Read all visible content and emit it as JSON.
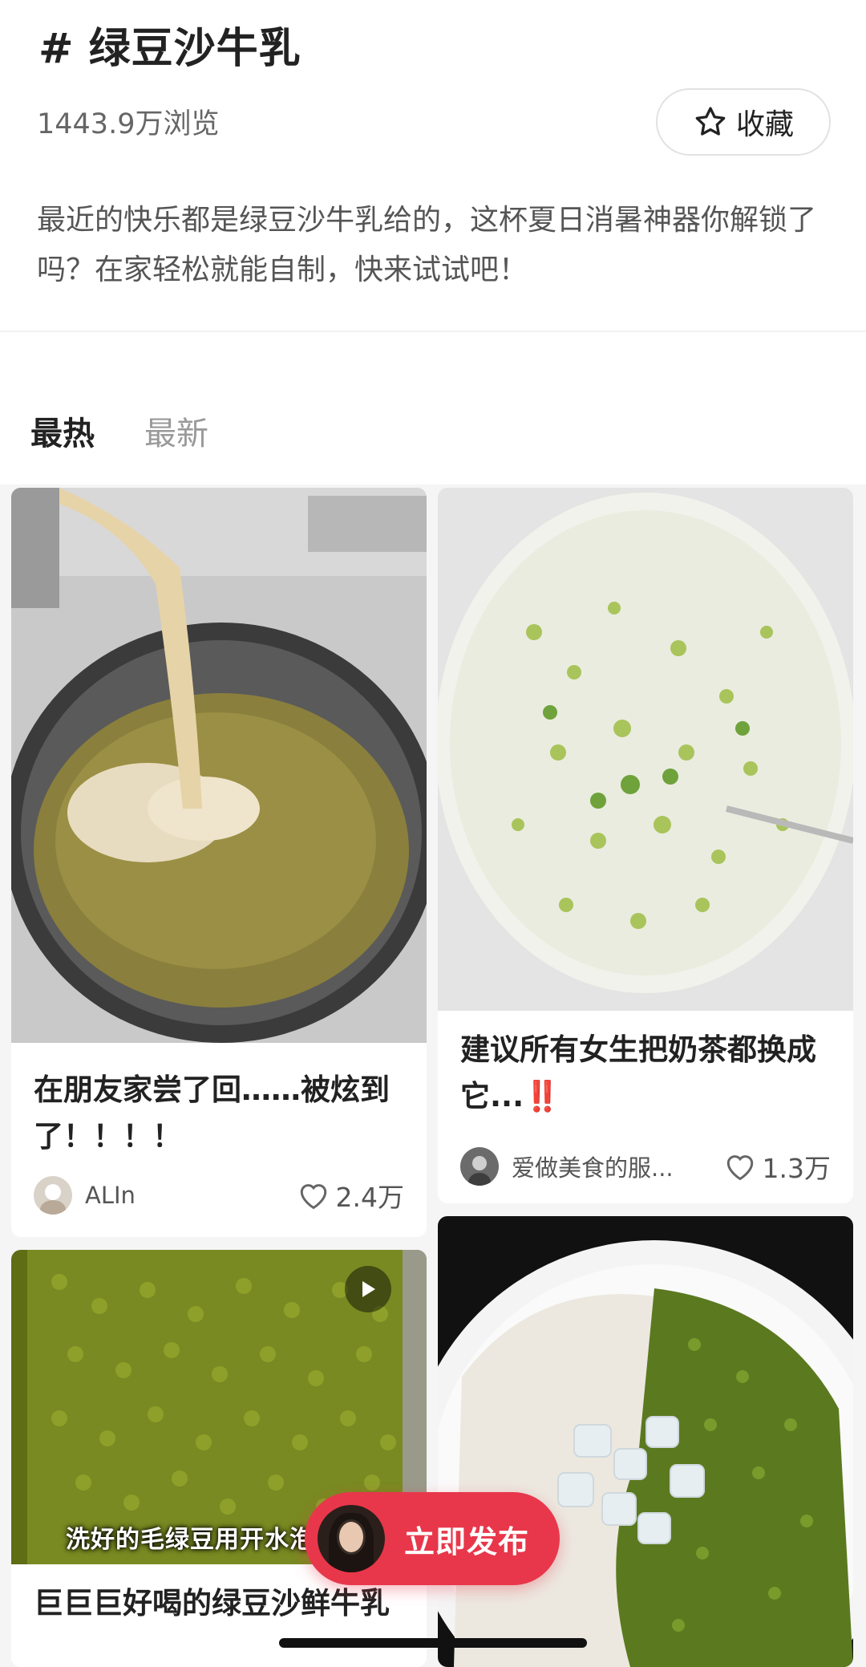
{
  "topic": {
    "hash": "#",
    "title": "绿豆沙牛乳",
    "views": "1443.9万浏览",
    "favorite_label": "收藏",
    "description": "最近的快乐都是绿豆沙牛乳给的，这杯夏日消暑神器你解锁了吗？在家轻松就能自制，快来试试吧！"
  },
  "tabs": [
    {
      "label": "最热",
      "active": true
    },
    {
      "label": "最新",
      "active": false
    }
  ],
  "posts": [
    {
      "title": "在朋友家尝了回……被炫到了！！！！",
      "author": "ALIn",
      "likes": "2.4万"
    },
    {
      "title": "建议所有女生把奶茶都换成它...",
      "title_emoji": "‼️",
      "author": "爱做美食的服...",
      "likes": "1.3万"
    },
    {
      "title": "巨巨巨好喝的绿豆沙鲜牛乳",
      "image_overlay_text": "洗好的毛绿豆用开水泡",
      "is_video": true
    },
    {
      "title": ""
    }
  ],
  "publish": {
    "label": "立即发布"
  },
  "colors": {
    "accent": "#e8364a",
    "bean_green": "#6e8a1e",
    "milk": "#efe9dc"
  }
}
